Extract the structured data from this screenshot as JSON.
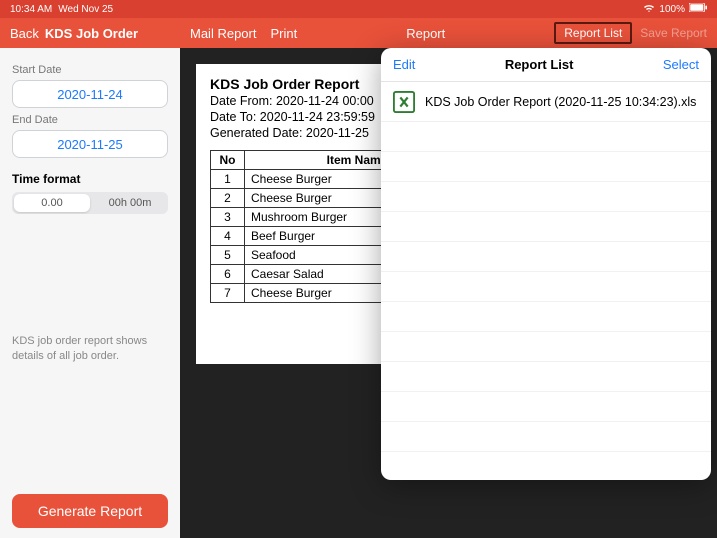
{
  "status": {
    "time": "10:34 AM",
    "date": "Wed Nov 25",
    "battery": "100%"
  },
  "header": {
    "back": "Back",
    "title": "KDS Job Order",
    "mail": "Mail Report",
    "print": "Print",
    "center": "Report",
    "report_list": "Report List",
    "save_report": "Save Report"
  },
  "sidebar": {
    "start_label": "Start Date",
    "start_value": "2020-11-24",
    "end_label": "End Date",
    "end_value": "2020-11-25",
    "timefmt_label": "Time format",
    "seg_decimal": "0.00",
    "seg_hm": "00h 00m",
    "help_text": "KDS job order report shows details of all job order.",
    "generate": "Generate Report"
  },
  "report": {
    "title": "KDS Job Order Report",
    "date_from": "Date From: 2020-11-24 00:00",
    "date_to": "Date To: 2020-11-24 23:59:59",
    "generated": "Generated Date: 2020-11-25",
    "col_no": "No",
    "col_item": "Item Name",
    "rows": [
      {
        "no": "1",
        "name": "Cheese Burger"
      },
      {
        "no": "2",
        "name": "Cheese Burger"
      },
      {
        "no": "3",
        "name": "Mushroom Burger"
      },
      {
        "no": "4",
        "name": "Beef Burger"
      },
      {
        "no": "5",
        "name": "Seafood"
      },
      {
        "no": "6",
        "name": "Caesar Salad"
      },
      {
        "no": "7",
        "name": "Cheese Burger"
      }
    ]
  },
  "popover": {
    "edit": "Edit",
    "title": "Report List",
    "select": "Select",
    "files": [
      {
        "name": "KDS Job Order Report (2020-11-25 10:34:23).xls"
      }
    ]
  }
}
